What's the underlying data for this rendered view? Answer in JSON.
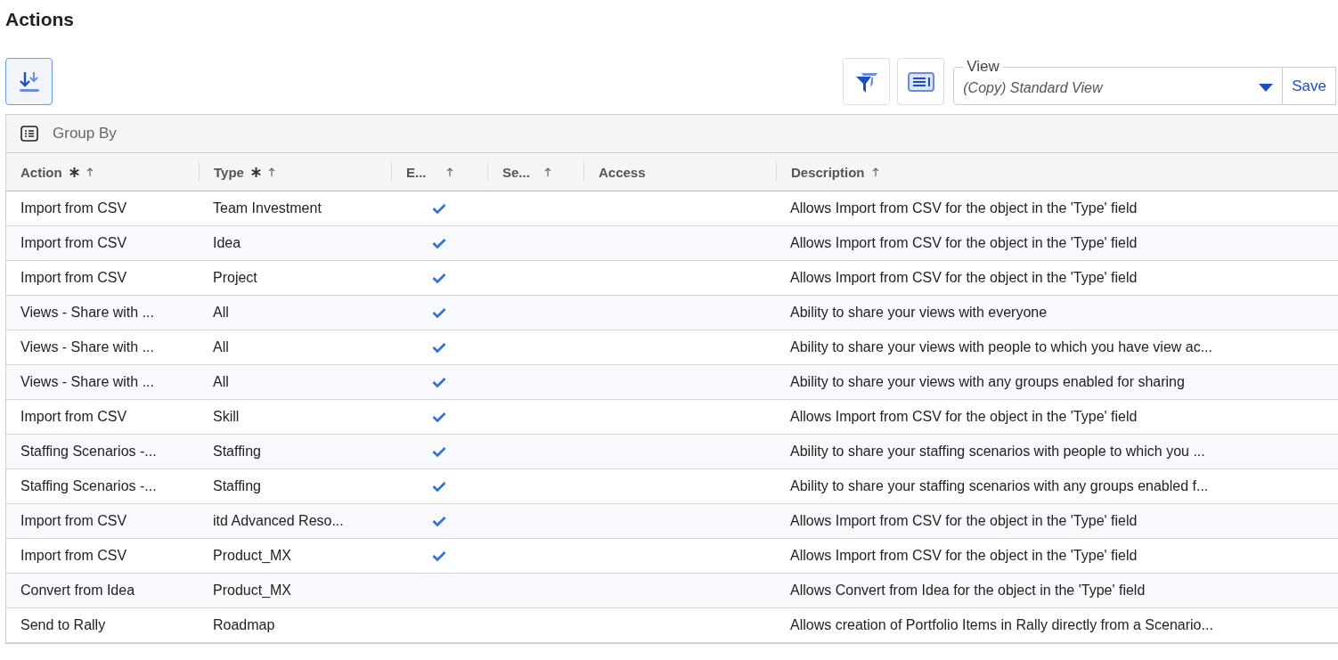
{
  "page": {
    "title": "Actions"
  },
  "toolbar": {
    "view_label": "View",
    "view_value": "(Copy) Standard View",
    "save_label": "Save"
  },
  "group_by": {
    "label": "Group By"
  },
  "table": {
    "columns": [
      {
        "label": "Action",
        "required": true,
        "sortable": true
      },
      {
        "label": "Type",
        "required": true,
        "sortable": true
      },
      {
        "label": "E...",
        "required": false,
        "sortable": true
      },
      {
        "label": "Se...",
        "required": false,
        "sortable": true
      },
      {
        "label": "Access",
        "required": false,
        "sortable": false
      },
      {
        "label": "Description",
        "required": false,
        "sortable": true
      }
    ],
    "rows": [
      {
        "action": "Import from CSV",
        "type": "Team Investment",
        "enabled": true,
        "description": "Allows Import from CSV for the object in the 'Type' field"
      },
      {
        "action": "Import from CSV",
        "type": "Idea",
        "enabled": true,
        "description": "Allows Import from CSV for the object in the 'Type' field"
      },
      {
        "action": "Import from CSV",
        "type": "Project",
        "enabled": true,
        "description": "Allows Import from CSV for the object in the 'Type' field"
      },
      {
        "action": "Views - Share with ...",
        "type": "All",
        "enabled": true,
        "description": "Ability to share your views with everyone"
      },
      {
        "action": "Views - Share with ...",
        "type": "All",
        "enabled": true,
        "description": "Ability to share your views with people to which you have view ac..."
      },
      {
        "action": "Views - Share with ...",
        "type": "All",
        "enabled": true,
        "description": "Ability to share your views with any groups enabled for sharing"
      },
      {
        "action": "Import from CSV",
        "type": "Skill",
        "enabled": true,
        "description": "Allows Import from CSV for the object in the 'Type' field"
      },
      {
        "action": "Staffing Scenarios -...",
        "type": "Staffing",
        "enabled": true,
        "description": "Ability to share your staffing scenarios with people to which you ..."
      },
      {
        "action": "Staffing Scenarios -...",
        "type": "Staffing",
        "enabled": true,
        "description": "Ability to share your staffing scenarios with any groups enabled f..."
      },
      {
        "action": "Import from CSV",
        "type": "itd Advanced Reso...",
        "enabled": true,
        "description": "Allows Import from CSV for the object in the 'Type' field"
      },
      {
        "action": "Import from CSV",
        "type": "Product_MX",
        "enabled": true,
        "description": "Allows Import from CSV for the object in the 'Type' field"
      },
      {
        "action": "Convert from Idea",
        "type": "Product_MX",
        "enabled": false,
        "description": "Allows Convert from Idea for the object in the 'Type' field"
      },
      {
        "action": "Send to Rally",
        "type": "Roadmap",
        "enabled": false,
        "description": "Allows creation of Portfolio Items in Rally directly from a Scenario..."
      }
    ]
  }
}
